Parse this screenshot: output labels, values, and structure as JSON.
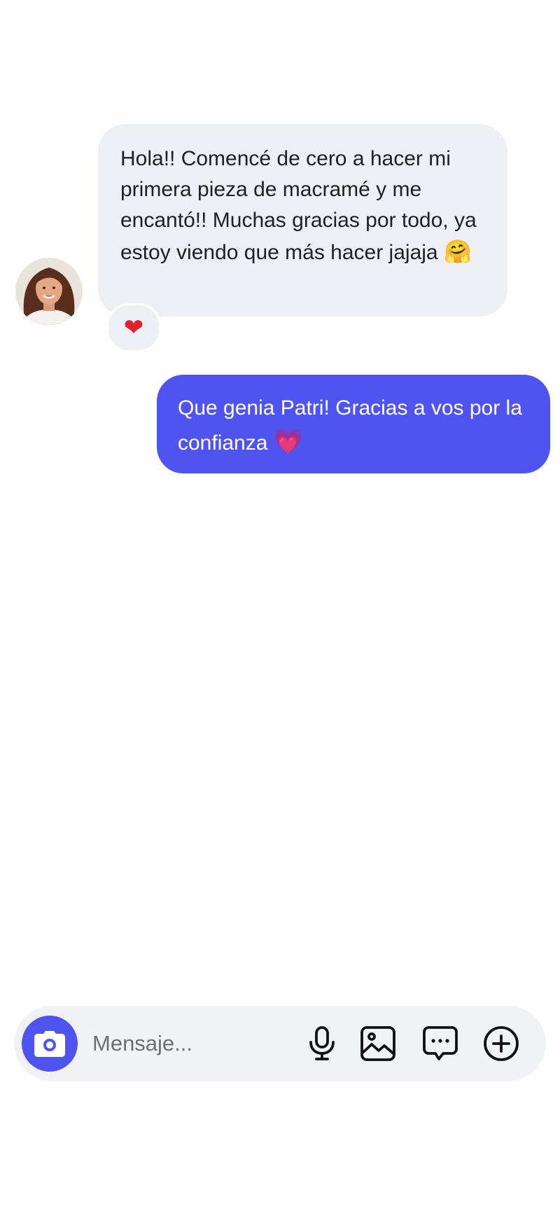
{
  "conversation": {
    "incoming": {
      "text": "Hola!! Comencé de cero a hacer mi primera pieza de macramé y me encantó!! Muchas gracias por todo, ya estoy viendo que más hacer jajaja",
      "emoji": "🤗",
      "reaction": "❤",
      "avatar_icon": "profile-photo"
    },
    "outgoing": {
      "text": "Que genia Patri! Gracias a vos por la confianza",
      "emoji": "💗"
    }
  },
  "composer": {
    "placeholder": "Mensaje...",
    "value": "",
    "icons": [
      "camera-icon",
      "microphone-icon",
      "image-icon",
      "chat-bubble-icon",
      "plus-circle-icon"
    ]
  },
  "colors": {
    "accent": "#4f53ef",
    "incoming_bubble": "#eeeff4",
    "background": "#fefefe",
    "composer_bg": "#f1f2f6"
  }
}
